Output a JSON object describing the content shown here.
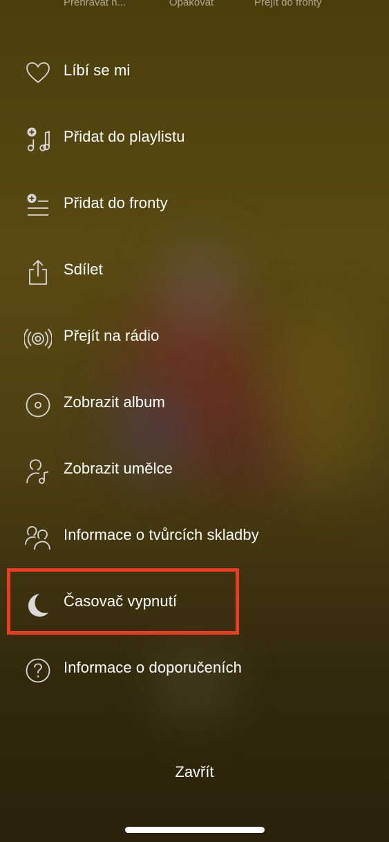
{
  "top_tabs": [
    {
      "label": "Přehrávat n..."
    },
    {
      "label": "Opakovat"
    },
    {
      "label": "Přejít do fronty"
    }
  ],
  "menu": {
    "items": [
      {
        "label": "Líbí se mi",
        "icon": "heart-icon"
      },
      {
        "label": "Přidat do playlistu",
        "icon": "add-to-playlist-icon"
      },
      {
        "label": "Přidat do fronty",
        "icon": "add-to-queue-icon"
      },
      {
        "label": "Sdílet",
        "icon": "share-icon"
      },
      {
        "label": "Přejít na rádio",
        "icon": "radio-icon"
      },
      {
        "label": "Zobrazit album",
        "icon": "album-icon"
      },
      {
        "label": "Zobrazit umělce",
        "icon": "artist-icon"
      },
      {
        "label": "Informace o tvůrcích skladby",
        "icon": "credits-icon"
      },
      {
        "label": "Časovač vypnutí",
        "icon": "moon-icon",
        "highlighted": true
      },
      {
        "label": "Informace o doporučeních",
        "icon": "question-icon"
      }
    ]
  },
  "close_label": "Zavřít",
  "colors": {
    "highlight": "#ea3e24",
    "text": "#ffffff",
    "icon": "#d9d9d9"
  }
}
